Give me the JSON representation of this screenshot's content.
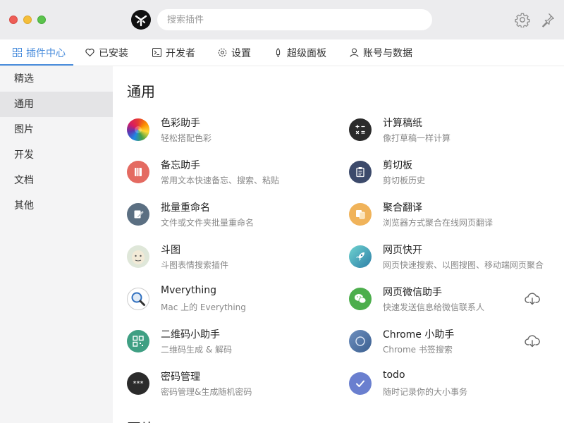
{
  "search": {
    "placeholder": "搜索插件",
    "value": ""
  },
  "tabs": [
    {
      "label": "插件中心",
      "icon": "grid-icon",
      "active": true
    },
    {
      "label": "已安装",
      "icon": "heart-icon"
    },
    {
      "label": "开发者",
      "icon": "terminal-icon"
    },
    {
      "label": "设置",
      "icon": "gear-icon"
    },
    {
      "label": "超级面板",
      "icon": "rocket-icon"
    },
    {
      "label": "账号与数据",
      "icon": "user-icon"
    }
  ],
  "sidebar": {
    "items": [
      {
        "label": "精选"
      },
      {
        "label": "通用",
        "active": true
      },
      {
        "label": "图片"
      },
      {
        "label": "开发"
      },
      {
        "label": "文档"
      },
      {
        "label": "其他"
      }
    ]
  },
  "section": {
    "title": "通用",
    "next_title": "图片"
  },
  "plugins": [
    {
      "name": "色彩助手",
      "desc": "轻松搭配色彩",
      "icon": "color-wheel-icon"
    },
    {
      "name": "计算稿纸",
      "desc": "像打草稿一样计算",
      "icon": "calculator-icon"
    },
    {
      "name": "备忘助手",
      "desc": "常用文本快速备忘、搜索、粘贴",
      "icon": "memo-icon"
    },
    {
      "name": "剪切板",
      "desc": "剪切板历史",
      "icon": "clipboard-icon"
    },
    {
      "name": "批量重命名",
      "desc": "文件或文件夹批量重命名",
      "icon": "rename-icon"
    },
    {
      "name": "聚合翻译",
      "desc": "浏览器方式聚合在线网页翻译",
      "icon": "translate-icon"
    },
    {
      "name": "斗图",
      "desc": "斗图表情搜索插件",
      "icon": "meme-face-icon"
    },
    {
      "name": "网页快开",
      "desc": "网页快速搜索、以图搜图、移动端网页聚合",
      "icon": "rocket-launch-icon"
    },
    {
      "name": "Mverything",
      "desc": "Mac 上的 Everything",
      "icon": "magnifier-icon"
    },
    {
      "name": "网页微信助手",
      "desc": "快速发送信息给微信联系人",
      "icon": "wechat-icon",
      "cloud": true
    },
    {
      "name": "二维码小助手",
      "desc": "二维码生成 & 解码",
      "icon": "qrcode-icon"
    },
    {
      "name": "Chrome 小助手",
      "desc": "Chrome 书签搜索",
      "icon": "chrome-icon",
      "cloud": true
    },
    {
      "name": "密码管理",
      "desc": "密码管理&生成随机密码",
      "icon": "password-icon"
    },
    {
      "name": "todo",
      "desc": "随时记录你的大小事务",
      "icon": "check-icon"
    }
  ],
  "colors": {
    "accent": "#4a8ddc",
    "sidebar_bg": "#f4f4f5",
    "sidebar_active": "#e4e4e6",
    "titlebar_bg": "#ececee"
  }
}
